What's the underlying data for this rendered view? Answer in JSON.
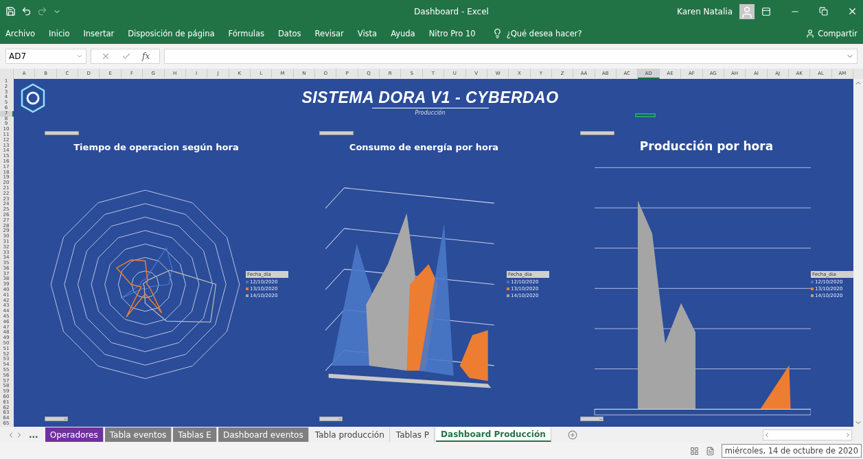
{
  "window": {
    "title": "Dashboard - Excel",
    "user": "Karen Natalia"
  },
  "quick_access": {
    "redo_disabled": true
  },
  "ribbon": {
    "tabs": [
      "Archivo",
      "Inicio",
      "Insertar",
      "Disposición de página",
      "Fórmulas",
      "Datos",
      "Revisar",
      "Vista",
      "Ayuda",
      "Nitro Pro 10"
    ],
    "search_placeholder": "¿Qué desea hacer?",
    "share": "Compartir"
  },
  "formula_bar": {
    "name_box": "AD7",
    "fx": "fx"
  },
  "columns": [
    {
      "label": "A",
      "selected": false
    },
    {
      "label": "B",
      "selected": false
    },
    {
      "label": "C",
      "selected": false
    },
    {
      "label": "D",
      "selected": false
    },
    {
      "label": "E",
      "selected": false
    },
    {
      "label": "F",
      "selected": false
    },
    {
      "label": "G",
      "selected": false
    },
    {
      "label": "H",
      "selected": false
    },
    {
      "label": "I",
      "selected": false
    },
    {
      "label": "J",
      "selected": false
    },
    {
      "label": "K",
      "selected": false
    },
    {
      "label": "L",
      "selected": false
    },
    {
      "label": "M",
      "selected": false
    },
    {
      "label": "N",
      "selected": false
    },
    {
      "label": "O",
      "selected": false
    },
    {
      "label": "P",
      "selected": false
    },
    {
      "label": "Q",
      "selected": false
    },
    {
      "label": "R",
      "selected": false
    },
    {
      "label": "S",
      "selected": false
    },
    {
      "label": "T",
      "selected": false
    },
    {
      "label": "U",
      "selected": false
    },
    {
      "label": "V",
      "selected": false
    },
    {
      "label": "W",
      "selected": false
    },
    {
      "label": "X",
      "selected": false
    },
    {
      "label": "Y",
      "selected": false
    },
    {
      "label": "Z",
      "selected": false
    },
    {
      "label": "AA",
      "selected": false
    },
    {
      "label": "AB",
      "selected": false
    },
    {
      "label": "AC",
      "selected": false
    },
    {
      "label": "AD",
      "selected": true
    },
    {
      "label": "AE",
      "selected": false
    },
    {
      "label": "AF",
      "selected": false
    },
    {
      "label": "AG",
      "selected": false
    },
    {
      "label": "AH",
      "selected": false
    },
    {
      "label": "AI",
      "selected": false
    },
    {
      "label": "AJ",
      "selected": false
    },
    {
      "label": "AK",
      "selected": false
    },
    {
      "label": "AL",
      "selected": false
    },
    {
      "label": "AM",
      "selected": false
    }
  ],
  "rows": [
    {
      "label": "1",
      "selected": false
    },
    {
      "label": "2",
      "selected": false
    },
    {
      "label": "3",
      "selected": false
    },
    {
      "label": "4",
      "selected": false
    },
    {
      "label": "5",
      "selected": false
    },
    {
      "label": "6",
      "selected": false
    },
    {
      "label": "7",
      "selected": true
    },
    {
      "label": "8",
      "selected": false
    },
    {
      "label": "9",
      "selected": false
    },
    {
      "label": "10",
      "selected": false
    },
    {
      "label": "11",
      "selected": false
    },
    {
      "label": "12",
      "selected": false
    },
    {
      "label": "13",
      "selected": false
    },
    {
      "label": "14",
      "selected": false
    },
    {
      "label": "15",
      "selected": false
    },
    {
      "label": "16",
      "selected": false
    },
    {
      "label": "17",
      "selected": false
    },
    {
      "label": "18",
      "selected": false
    },
    {
      "label": "19",
      "selected": false
    },
    {
      "label": "20",
      "selected": false
    },
    {
      "label": "21",
      "selected": false
    },
    {
      "label": "22",
      "selected": false
    },
    {
      "label": "23",
      "selected": false
    },
    {
      "label": "24",
      "selected": false
    },
    {
      "label": "25",
      "selected": false
    },
    {
      "label": "26",
      "selected": false
    },
    {
      "label": "27",
      "selected": false
    },
    {
      "label": "28",
      "selected": false
    },
    {
      "label": "29",
      "selected": false
    },
    {
      "label": "30",
      "selected": false
    },
    {
      "label": "31",
      "selected": false
    },
    {
      "label": "32",
      "selected": false
    },
    {
      "label": "33",
      "selected": false
    },
    {
      "label": "34",
      "selected": false
    },
    {
      "label": "35",
      "selected": false
    },
    {
      "label": "36",
      "selected": false
    },
    {
      "label": "37",
      "selected": false
    },
    {
      "label": "38",
      "selected": false
    },
    {
      "label": "39",
      "selected": false
    },
    {
      "label": "40",
      "selected": false
    },
    {
      "label": "41",
      "selected": false
    },
    {
      "label": "42",
      "selected": false
    },
    {
      "label": "43",
      "selected": false
    },
    {
      "label": "44",
      "selected": false
    },
    {
      "label": "45",
      "selected": false
    },
    {
      "label": "46",
      "selected": false
    },
    {
      "label": "47",
      "selected": false
    },
    {
      "label": "48",
      "selected": false
    },
    {
      "label": "49",
      "selected": false
    },
    {
      "label": "50",
      "selected": false
    },
    {
      "label": "51",
      "selected": false
    },
    {
      "label": "52",
      "selected": false
    },
    {
      "label": "53",
      "selected": false
    },
    {
      "label": "54",
      "selected": false
    },
    {
      "label": "55",
      "selected": false
    },
    {
      "label": "56",
      "selected": false
    },
    {
      "label": "57",
      "selected": false
    },
    {
      "label": "58",
      "selected": false
    },
    {
      "label": "59",
      "selected": false
    },
    {
      "label": "60",
      "selected": false
    },
    {
      "label": "61",
      "selected": false
    },
    {
      "label": "62",
      "selected": false
    },
    {
      "label": "63",
      "selected": false
    },
    {
      "label": "64",
      "selected": false
    },
    {
      "label": "65",
      "selected": false
    }
  ],
  "dashboard": {
    "title": "SISTEMA DORA V1 - CYBERDAO",
    "subtitle": "Producción",
    "charts": [
      {
        "kind": "radar",
        "title": "Tiempo de operacion según hora",
        "legend_title": "Fecha_dia",
        "legend": [
          {
            "label": "12/10/2020",
            "color": "#4472c4"
          },
          {
            "label": "13/10/2020",
            "color": "#ed7d31"
          },
          {
            "label": "14/10/2020",
            "color": "#a5a5a5"
          }
        ]
      },
      {
        "kind": "area3d",
        "title": "Consumo de energía por hora",
        "legend_title": "Fecha_dia",
        "legend": [
          {
            "label": "12/10/2020",
            "color": "#4472c4"
          },
          {
            "label": "13/10/2020",
            "color": "#ed7d31"
          },
          {
            "label": "14/10/2020",
            "color": "#a5a5a5"
          }
        ]
      },
      {
        "kind": "area",
        "title": "Producción por hora",
        "legend_title": "Fecha_dia",
        "legend": [
          {
            "label": "12/10/2020",
            "color": "#4472c4"
          },
          {
            "label": "13/10/2020",
            "color": "#ed7d31"
          },
          {
            "label": "14/10/2020",
            "color": "#a5a5a5"
          }
        ]
      }
    ]
  },
  "sheet_tabs": {
    "overflow": "...",
    "tabs": [
      {
        "label": "Operadores",
        "selected": false,
        "color": "#7030a0"
      },
      {
        "label": "Tabla eventos",
        "selected": false,
        "color": "#7f7f7f"
      },
      {
        "label": "Tablas E",
        "selected": false,
        "color": "#7f7f7f"
      },
      {
        "label": "Dashboard eventos",
        "selected": false,
        "color": "#7f7f7f"
      },
      {
        "label": "Tabla producción",
        "selected": false
      },
      {
        "label": "Tablas P",
        "selected": false
      },
      {
        "label": "Dashboard Producción",
        "selected": true
      }
    ]
  },
  "status_bar": {
    "date": "miércoles, 14 de octubre de 2020"
  }
}
